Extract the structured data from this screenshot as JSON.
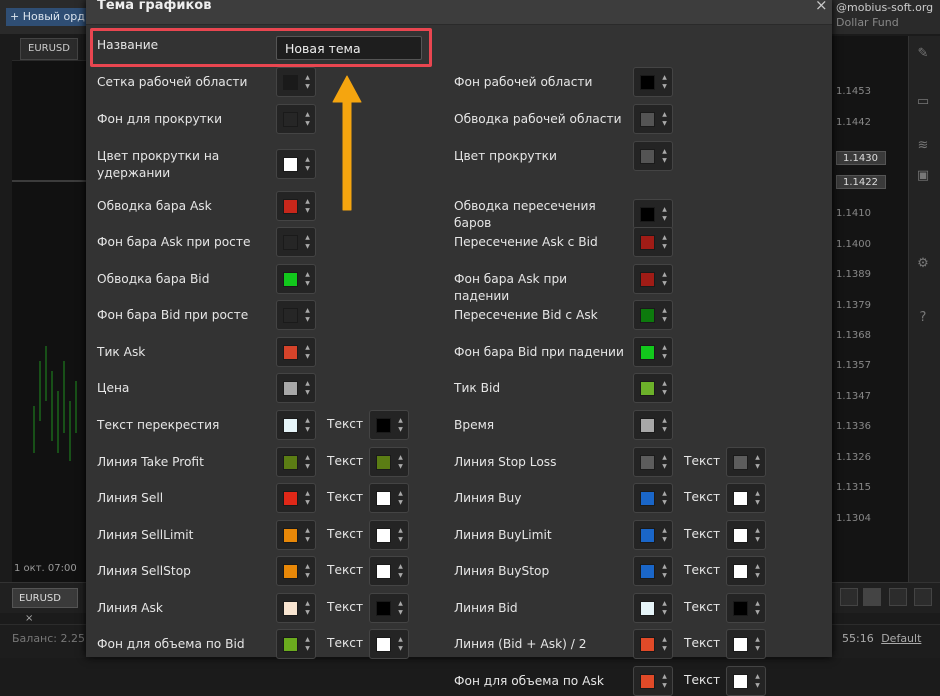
{
  "app": {
    "new_order_btn": "+ Новый орд",
    "account": "@mobius-soft.org",
    "account_sub": "Dollar Fund",
    "chart_tab": "EURUSD",
    "date_label": "1 окт. 07:00",
    "symbol_tab": "EURUSD",
    "symbol_tab_close": "×",
    "balance_label": "Баланс: 2.25",
    "time_label": "55:16",
    "default_label": "Default",
    "prices": [
      "1.1453",
      "1.1442",
      "1.1430",
      "1.1422",
      "1.1410",
      "1.1400",
      "1.1389",
      "1.1379",
      "1.1368",
      "1.1357",
      "1.1347",
      "1.1336",
      "1.1326",
      "1.1315",
      "1.1304"
    ],
    "side_icons": [
      "eraser-icon",
      "monitor-icon",
      "signal-icon",
      "terminal-icon",
      "gear-icon",
      "help-icon"
    ]
  },
  "dialog": {
    "title": "Тема графиков",
    "close": "×",
    "name_label": "Название",
    "name_value": "Новая тема",
    "text_label": "Текст",
    "left_rows": [
      {
        "label": "Сетка рабочей области",
        "color": "#1a1a1a"
      },
      {
        "label": "Фон для прокрутки",
        "color": "#262626"
      },
      {
        "label": "Цвет прокрутки на удержании",
        "color": "#ffffff"
      },
      {
        "label": "Обводка бара Ask",
        "color": "#c8271b"
      },
      {
        "label": "Фон бара Ask при росте",
        "color": "#262626"
      },
      {
        "label": "Обводка бара Bid",
        "color": "#12c81c"
      },
      {
        "label": "Фон бара Bid при росте",
        "color": "#262626"
      },
      {
        "label": "Тик Ask",
        "color": "#d5432a"
      },
      {
        "label": "Цена",
        "color": "#a8a8a8"
      },
      {
        "label": "Текст перекрестия",
        "color": "#e6f4f8",
        "text_color": "#000000"
      },
      {
        "label": "Линия Take Profit",
        "color": "#5b7d14",
        "text_color": "#5b7d14"
      },
      {
        "label": "Линия Sell",
        "color": "#e02818",
        "text_color": "#ffffff"
      },
      {
        "label": "Линия SellLimit",
        "color": "#e88808",
        "text_color": "#ffffff"
      },
      {
        "label": "Линия SellStop",
        "color": "#e88808",
        "text_color": "#ffffff"
      },
      {
        "label": "Линия Ask",
        "color": "#f8e4d0",
        "text_color": "#000000"
      },
      {
        "label": "Фон для объема по Bid",
        "color": "#6bab1e",
        "text_color": "#ffffff"
      }
    ],
    "right_rows": [
      {
        "label": "Фон рабочей области",
        "color": "#000000"
      },
      {
        "label": "Обводка рабочей области",
        "color": "#545454"
      },
      {
        "label": "Цвет прокрутки",
        "color": "#545454"
      },
      {
        "label": "Обводка пересечения баров",
        "color": "#000000"
      },
      {
        "label": "Пересечение Ask с Bid",
        "color": "#a01c16"
      },
      {
        "label": "Фон бара Ask при падении",
        "color": "#a01c16"
      },
      {
        "label": "Пересечение Bid с Ask",
        "color": "#0d7a0d"
      },
      {
        "label": "Фон бара Bid при падении",
        "color": "#12c81c"
      },
      {
        "label": "Тик Bid",
        "color": "#6cb12a"
      },
      {
        "label": "Время",
        "color": "#a8a8a8"
      },
      {
        "label": "Линия Stop Loss",
        "color": "#5c5c5c",
        "text_color": "#5c5c5c"
      },
      {
        "label": "Линия Buy",
        "color": "#1a66c8",
        "text_color": "#ffffff"
      },
      {
        "label": "Линия BuyLimit",
        "color": "#1a66c8",
        "text_color": "#ffffff"
      },
      {
        "label": "Линия BuyStop",
        "color": "#1a66c8",
        "text_color": "#ffffff"
      },
      {
        "label": "Линия Bid",
        "color": "#e6f4f8",
        "text_color": "#000000"
      },
      {
        "label": "Линия (Bid + Ask) / 2",
        "color": "#e04a28",
        "text_color": "#ffffff"
      },
      {
        "label": "Фон для объема по Ask",
        "color": "#e04a28",
        "text_color": "#ffffff"
      }
    ]
  },
  "annotation": {
    "highlight_color": "#e94650",
    "arrow_color": "#f5a50f"
  }
}
